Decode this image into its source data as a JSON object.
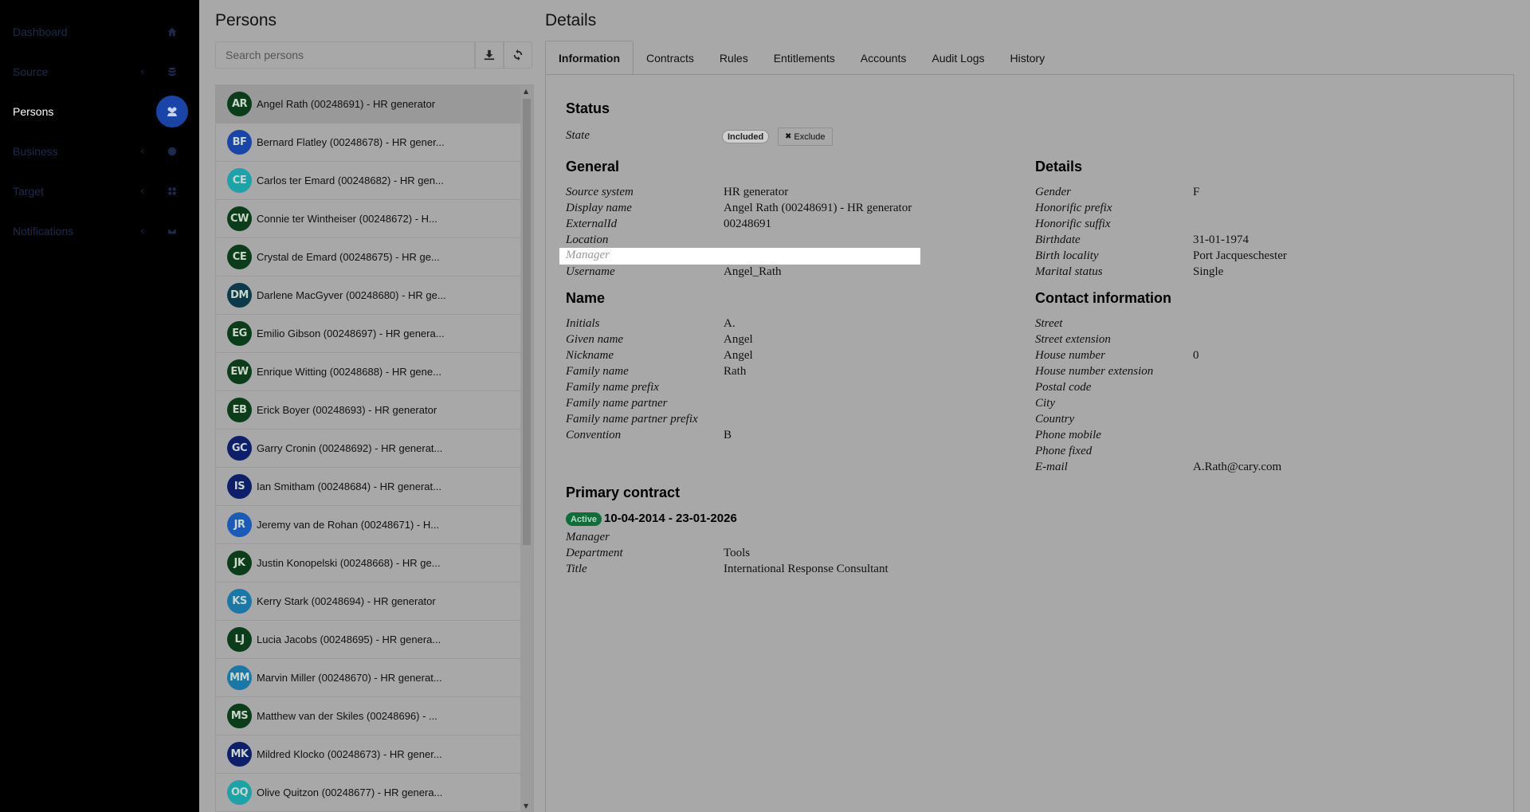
{
  "nav": {
    "items": [
      {
        "label": "Dashboard",
        "icon": "home-icon"
      },
      {
        "label": "Source",
        "icon": "database-icon",
        "chevron": "‹"
      },
      {
        "label": "Persons",
        "icon": "users-icon",
        "active": true
      },
      {
        "label": "Business",
        "icon": "globe-icon",
        "chevron": "‹"
      },
      {
        "label": "Target",
        "icon": "grid-icon",
        "chevron": "‹"
      },
      {
        "label": "Notifications",
        "icon": "envelope-icon",
        "chevron": "‹"
      }
    ]
  },
  "persons": {
    "title": "Persons",
    "search_placeholder": "Search persons",
    "list": [
      {
        "initials": "AR",
        "name": "Angel Rath (00248691) - HR generator",
        "color": "#0b3d1a",
        "selected": true
      },
      {
        "initials": "BF",
        "name": "Bernard Flatley (00248678) - HR gener...",
        "color": "#1a45a8"
      },
      {
        "initials": "CE",
        "name": "Carlos ter Emard (00248682) - HR gen...",
        "color": "#1aa3a8"
      },
      {
        "initials": "CW",
        "name": "Connie ter Wintheiser (00248672) - H...",
        "color": "#0b3d1a"
      },
      {
        "initials": "CE",
        "name": "Crystal de Emard (00248675) - HR ge...",
        "color": "#0b3d1a"
      },
      {
        "initials": "DM",
        "name": "Darlene MacGyver (00248680) - HR ge...",
        "color": "#0d3a4a"
      },
      {
        "initials": "EG",
        "name": "Emilio Gibson (00248697) - HR genera...",
        "color": "#0b3d1a"
      },
      {
        "initials": "EW",
        "name": "Enrique Witting (00248688) - HR gene...",
        "color": "#0b3d1a"
      },
      {
        "initials": "EB",
        "name": "Erick Boyer (00248693) - HR generator",
        "color": "#0b3d1a"
      },
      {
        "initials": "GC",
        "name": "Garry Cronin (00248692) - HR generat...",
        "color": "#0d1f6a"
      },
      {
        "initials": "IS",
        "name": "Ian Smitham (00248684) - HR generat...",
        "color": "#0d1f6a"
      },
      {
        "initials": "JR",
        "name": "Jeremy van de Rohan (00248671) - H...",
        "color": "#1a5ab8"
      },
      {
        "initials": "JK",
        "name": "Justin Konopelski (00248668) - HR ge...",
        "color": "#0b3d1a"
      },
      {
        "initials": "KS",
        "name": "Kerry Stark (00248694) - HR generator",
        "color": "#1a78a8"
      },
      {
        "initials": "LJ",
        "name": "Lucia Jacobs (00248695) - HR genera...",
        "color": "#0b3d1a"
      },
      {
        "initials": "MM",
        "name": "Marvin Miller (00248670) - HR generat...",
        "color": "#1a78a8"
      },
      {
        "initials": "MS",
        "name": "Matthew van der Skiles (00248696) - ...",
        "color": "#0b3d1a"
      },
      {
        "initials": "MK",
        "name": "Mildred Klocko (00248673) - HR gener...",
        "color": "#0d1f6a"
      },
      {
        "initials": "OQ",
        "name": "Olive Quitzon (00248677) - HR genera...",
        "color": "#1aa3a8"
      }
    ]
  },
  "details": {
    "title": "Details",
    "tabs": [
      "Information",
      "Contracts",
      "Rules",
      "Entitlements",
      "Accounts",
      "Audit Logs",
      "History"
    ],
    "status": {
      "heading": "Status",
      "state_label": "State",
      "state_badge": "Included",
      "exclude_label": "Exclude"
    },
    "general": {
      "heading": "General",
      "source_system_label": "Source system",
      "source_system": "HR generator",
      "display_name_label": "Display name",
      "display_name": "Angel Rath (00248691) - HR generator",
      "external_id_label": "ExternalId",
      "external_id": "00248691",
      "location_label": "Location",
      "manager_label": "Manager",
      "username_label": "Username",
      "username": "Angel_Rath"
    },
    "name": {
      "heading": "Name",
      "initials_label": "Initials",
      "initials": "A.",
      "given_name_label": "Given name",
      "given_name": "Angel",
      "nickname_label": "Nickname",
      "nickname": "Angel",
      "family_name_label": "Family name",
      "family_name": "Rath",
      "family_name_prefix_label": "Family name prefix",
      "family_name_partner_label": "Family name partner",
      "family_name_partner_prefix_label": "Family name partner prefix",
      "convention_label": "Convention",
      "convention": "B"
    },
    "personal": {
      "heading": "Details",
      "gender_label": "Gender",
      "gender": "F",
      "honorific_prefix_label": "Honorific prefix",
      "honorific_suffix_label": "Honorific suffix",
      "birthdate_label": "Birthdate",
      "birthdate": "31-01-1974",
      "birth_locality_label": "Birth locality",
      "birth_locality": "Port Jacqueschester",
      "marital_status_label": "Marital status",
      "marital_status": "Single"
    },
    "contact": {
      "heading": "Contact information",
      "street_label": "Street",
      "street_extension_label": "Street extension",
      "house_number_label": "House number",
      "house_number": "0",
      "house_number_extension_label": "House number extension",
      "postal_code_label": "Postal code",
      "city_label": "City",
      "country_label": "Country",
      "phone_mobile_label": "Phone mobile",
      "phone_fixed_label": "Phone fixed",
      "email_label": "E-mail",
      "email": "A.Rath@cary.com"
    },
    "contract": {
      "heading": "Primary contract",
      "status_badge": "Active",
      "dates": "10-04-2014 - 23-01-2026",
      "manager_label": "Manager",
      "department_label": "Department",
      "department": "Tools",
      "title_label": "Title",
      "title": "International Response Consultant"
    }
  }
}
